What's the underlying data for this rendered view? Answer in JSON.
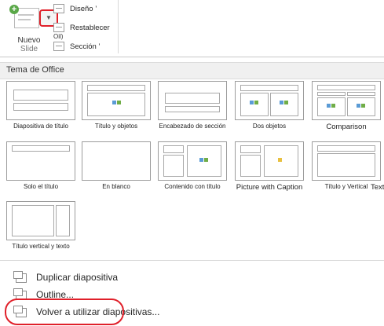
{
  "ribbon": {
    "new_slide": {
      "label_line1": "Nuevo",
      "label_line2": "Slide"
    },
    "commands": [
      {
        "label": "Diseño ’",
        "icon": "layout-icon"
      },
      {
        "label": "Restablecer",
        "icon": "reset-icon"
      },
      {
        "label": "Sección ’",
        "icon": "section-icon"
      }
    ],
    "kbd_hint": "Oil)"
  },
  "panel": {
    "header": "Tema de Office",
    "layouts": [
      {
        "label": "Diapositiva de título"
      },
      {
        "label": "Título y objetos"
      },
      {
        "label": "Encabezado de sección"
      },
      {
        "label": "Dos objetos"
      },
      {
        "label": "Comparison"
      },
      {
        "label": "Solo el título"
      },
      {
        "label": "En blanco"
      },
      {
        "label": "Contenido con título"
      },
      {
        "label": "Picture with Caption"
      },
      {
        "label": "Título y Vertical"
      },
      {
        "label": "Text"
      },
      {
        "label": "Título vertical y texto"
      }
    ]
  },
  "menu": {
    "items": [
      {
        "label": "Duplicar diapositiva",
        "icon": "duplicate-slide-icon"
      },
      {
        "label": "Outline...",
        "icon": "outline-icon"
      },
      {
        "label": "Volver a utilizar diapositivas...",
        "icon": "reuse-slides-icon"
      }
    ]
  },
  "colors": {
    "highlight": "#e0202a",
    "plus_badge": "#5aa848"
  }
}
